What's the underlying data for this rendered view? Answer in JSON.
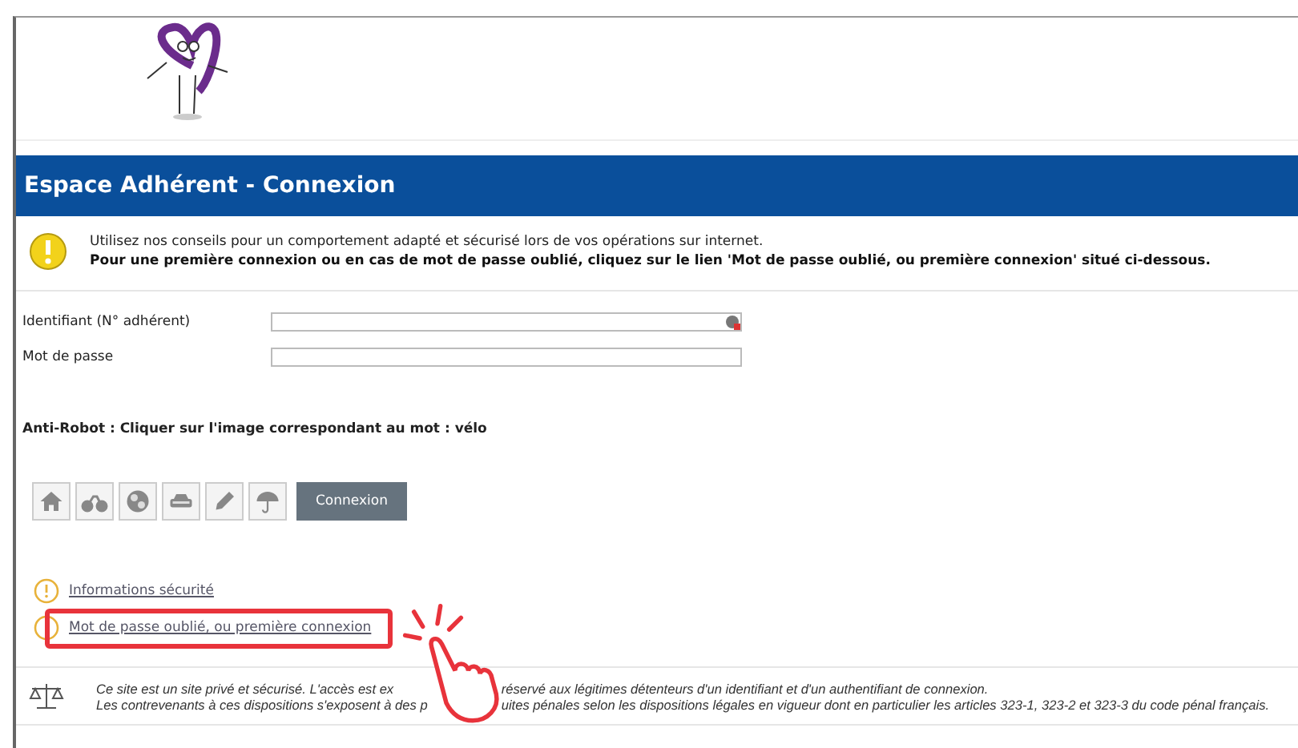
{
  "header": {
    "title": "Espace Adhérent - Connexion"
  },
  "notice": {
    "line_1": "Utilisez nos conseils pour un comportement adapté et sécurisé lors de vos opérations sur internet.",
    "line_2": "Pour une première connexion ou en cas de mot de passe oublié, cliquez sur le lien 'Mot de passe oublié, ou première connexion' situé ci-dessous."
  },
  "form": {
    "fields": [
      {
        "label": "Identifiant (N° adhérent)",
        "kind": "id"
      },
      {
        "label": "Mot de passe",
        "kind": "password"
      }
    ],
    "anti_robot": "Anti-Robot : Cliquer sur l'image correspondant au mot : vélo",
    "captcha_images": [
      {
        "kind": "house"
      },
      {
        "kind": "bike"
      },
      {
        "kind": "ball"
      },
      {
        "kind": "car"
      },
      {
        "kind": "pencil"
      },
      {
        "kind": "umbrella"
      }
    ],
    "submit": "Connexion"
  },
  "links": [
    {
      "label": "Informations sécurité",
      "highlighted": false
    },
    {
      "label": "Mot de passe oublié, ou première connexion",
      "highlighted": true
    }
  ],
  "footer": {
    "lines": [
      [
        "Ce site est un site privé et sécurisé. L'accès est ex",
        "réservé aux légitimes détenteurs d'un identifiant et d'un authentifiant de connexion."
      ],
      [
        "Les contrevenants à ces dispositions s'exposent à des p",
        "uites pénales selon les dispositions légales en vigueur dont en particulier les articles 323-1, 323-2 et 323-3 du code pénal français."
      ]
    ]
  }
}
